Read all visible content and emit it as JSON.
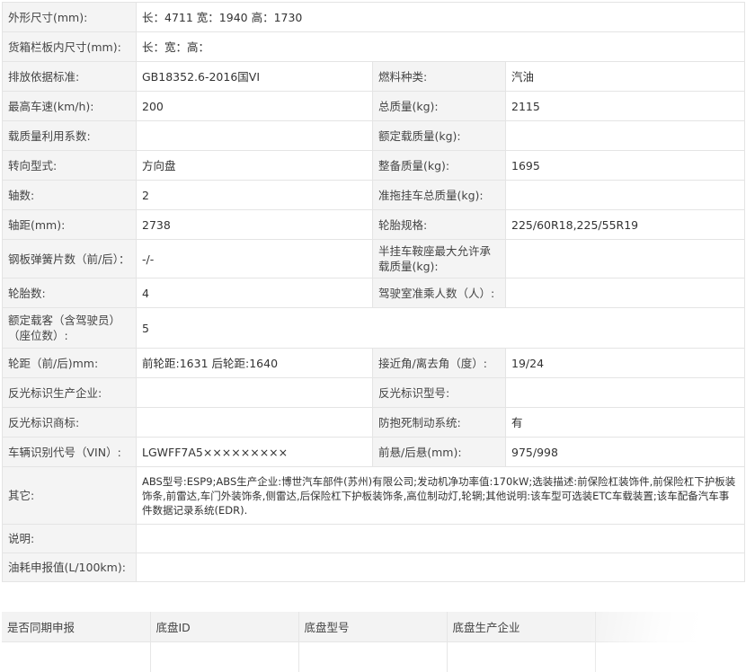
{
  "spec": {
    "dimensions_label": "外形尺寸(mm):",
    "dimensions_value": "长：4711 宽：1940 高：1730",
    "cargo_label": "货箱栏板内尺寸(mm):",
    "cargo_value": "长：宽：高：",
    "emission_label": "排放依据标准:",
    "emission_value": "GB18352.6-2016国VI",
    "fuel_label": "燃料种类:",
    "fuel_value": "汽油",
    "top_speed_label": "最高车速(km/h):",
    "top_speed_value": "200",
    "gross_mass_label": "总质量(kg):",
    "gross_mass_value": "2115",
    "load_ratio_label": "载质量利用系数:",
    "load_ratio_value": "",
    "rated_load_label": "额定载质量(kg):",
    "rated_load_value": "",
    "steering_label": "转向型式:",
    "steering_value": "方向盘",
    "curb_mass_label": "整备质量(kg):",
    "curb_mass_value": "1695",
    "axles_label": "轴数:",
    "axles_value": "2",
    "trailer_mass_label": "准拖挂车总质量(kg):",
    "trailer_mass_value": "",
    "wheelbase_label": "轴距(mm):",
    "wheelbase_value": "2738",
    "tire_spec_label": "轮胎规格:",
    "tire_spec_value": "225/60R18,225/55R19",
    "leaf_spring_label": "钢板弹簧片数（前/后）：",
    "leaf_spring_value": "-/-",
    "saddle_load_label": "半挂车鞍座最大允许承载质量(kg):",
    "saddle_load_value": "",
    "tire_count_label": "轮胎数:",
    "tire_count_value": "4",
    "cab_seats_label": "驾驶室准乘人数（人）:",
    "cab_seats_value": "",
    "passengers_label": "额定载客（含驾驶员）（座位数）:",
    "passengers_value": "5",
    "track_label": "轮距（前/后)mm:",
    "track_value": "前轮距:1631 后轮距:1640",
    "approach_label": "接近角/离去角（度）:",
    "approach_value": "19/24",
    "reflector_maker_label": "反光标识生产企业:",
    "reflector_maker_value": "",
    "reflector_model_label": "反光标识型号:",
    "reflector_model_value": "",
    "reflector_brand_label": "反光标识商标:",
    "reflector_brand_value": "",
    "abs_label": "防抱死制动系统:",
    "abs_value": "有",
    "vin_label": "车辆识别代号（VIN）:",
    "vin_value": "LGWFF7A5×××××××××",
    "overhang_label": "前悬/后悬(mm):",
    "overhang_value": "975/998",
    "other_label": "其它:",
    "other_value": "ABS型号:ESP9;ABS生产企业:博世汽车部件(苏州)有限公司;发动机净功率值:170kW;选装描述:前保险杠装饰件,前保险杠下护板装饰条,前雷达,车门外装饰条,侧雷达,后保险杠下护板装饰条,高位制动灯,轮辋;其他说明:该车型可选装ETC车载装置;该车配备汽车事件数据记录系统(EDR).",
    "note_label": "说明:",
    "note_value": "",
    "fuel_consumption_label": "油耗申报值(L/100km):",
    "fuel_consumption_value": ""
  },
  "chassis": {
    "col1": "是否同期申报",
    "col2": "底盘ID",
    "col3": "底盘型号",
    "col4": "底盘生产企业"
  }
}
